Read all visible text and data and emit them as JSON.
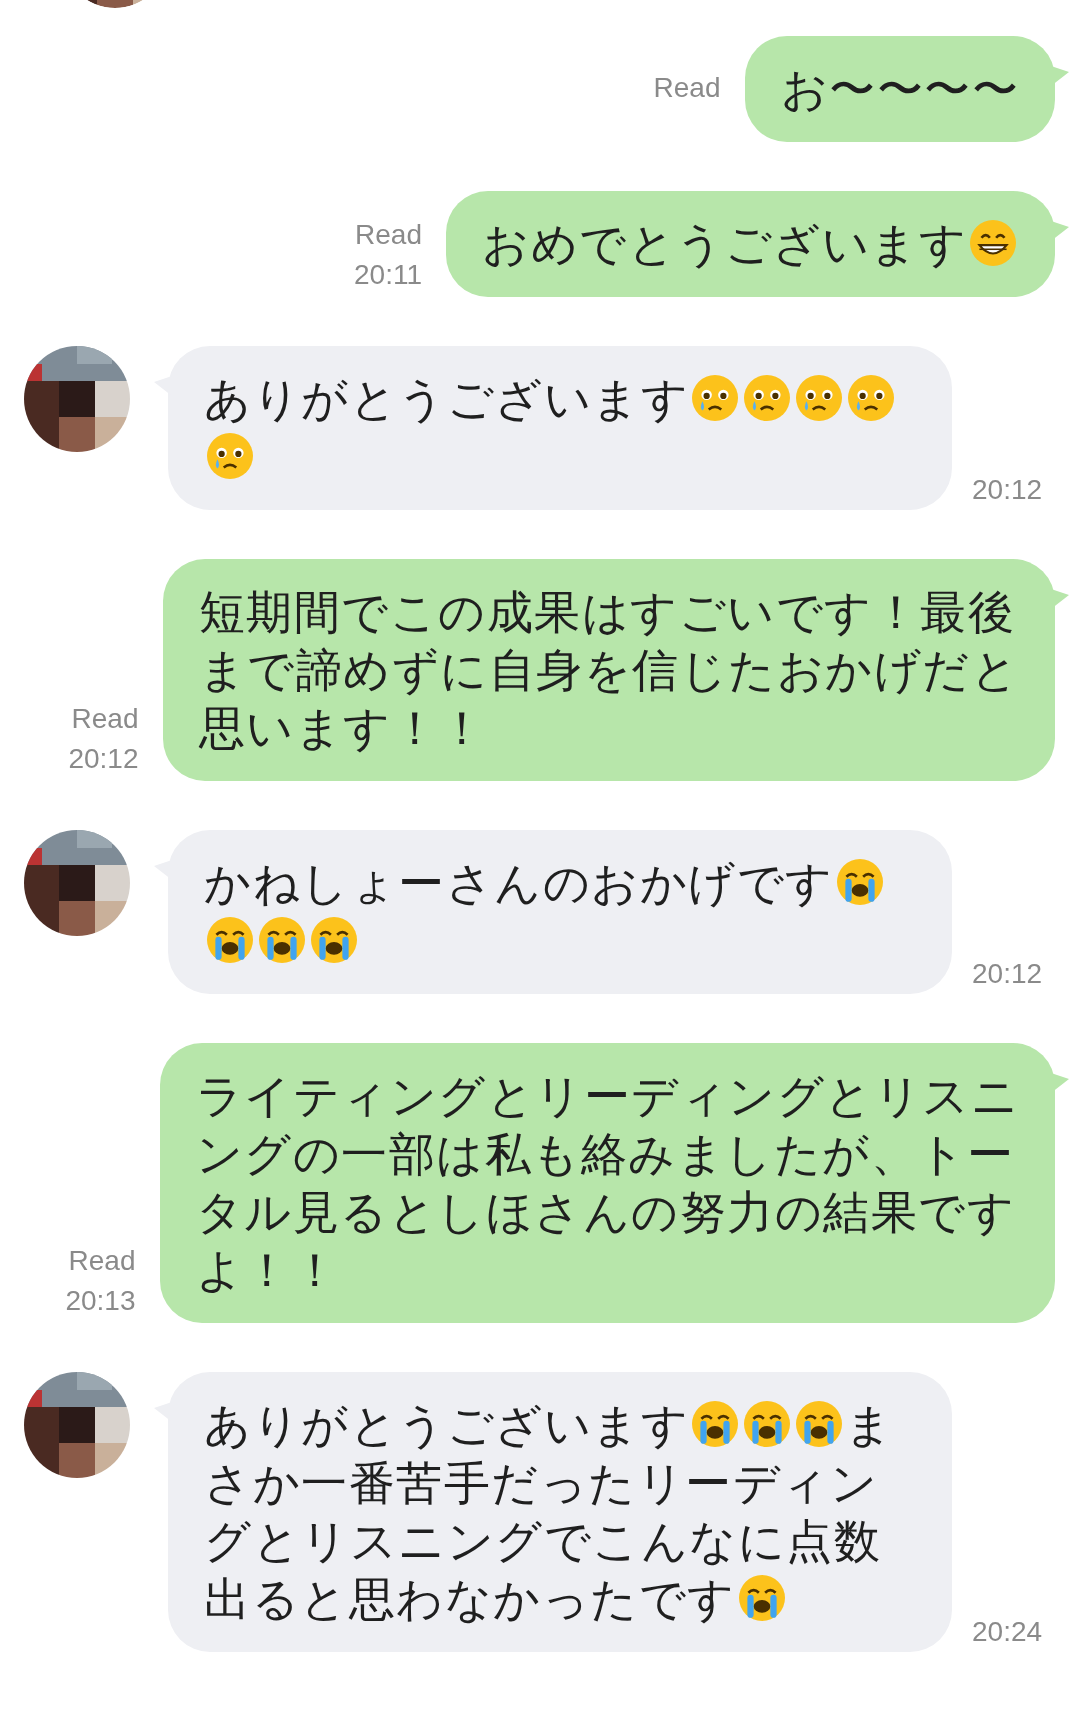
{
  "top_avatar": {
    "kind": "picture"
  },
  "messages": [
    {
      "kind": "sent",
      "read_label": "Read",
      "lines": [
        [
          {
            "kind": "text",
            "text": "お〜〜〜〜"
          }
        ]
      ]
    },
    {
      "kind": "sent",
      "read_label": "Read",
      "time": "20:11",
      "lines": [
        [
          {
            "kind": "text",
            "text": "おめでとうございます"
          },
          {
            "kind": "grin-emoji"
          }
        ]
      ]
    },
    {
      "kind": "received",
      "time": "20:12",
      "avatar": {
        "kind": "picture"
      },
      "lines": [
        [
          {
            "kind": "text",
            "text": "ありがとうございます"
          },
          {
            "kind": "tear-emoji"
          },
          {
            "kind": "tear-emoji"
          },
          {
            "kind": "tear-emoji"
          },
          {
            "kind": "tear-emoji"
          }
        ],
        [
          {
            "kind": "tear-emoji"
          }
        ]
      ]
    },
    {
      "kind": "sent",
      "read_label": "Read",
      "time": "20:12",
      "lines": [
        [
          {
            "kind": "text",
            "text": "短期間でこの成果はすごいです！最後"
          }
        ],
        [
          {
            "kind": "text",
            "text": "まで諦めずに自身を信じたおかげだと"
          }
        ],
        [
          {
            "kind": "text",
            "text": "思います！！"
          }
        ]
      ]
    },
    {
      "kind": "received",
      "time": "20:12",
      "avatar": {
        "kind": "picture"
      },
      "lines": [
        [
          {
            "kind": "text",
            "text": "かねしょーさんのおかげです"
          },
          {
            "kind": "sob-emoji"
          }
        ],
        [
          {
            "kind": "sob-emoji"
          },
          {
            "kind": "sob-emoji"
          },
          {
            "kind": "sob-emoji"
          }
        ]
      ]
    },
    {
      "kind": "sent",
      "read_label": "Read",
      "time": "20:13",
      "lines": [
        [
          {
            "kind": "text",
            "text": "ライティングとリーディングとリスニ"
          }
        ],
        [
          {
            "kind": "text",
            "text": "ングの一部は私も絡みましたが、トー"
          }
        ],
        [
          {
            "kind": "text",
            "text": "タル見るとしほさんの努力の結果です"
          }
        ],
        [
          {
            "kind": "text",
            "text": "よ！！"
          }
        ]
      ]
    },
    {
      "kind": "received",
      "time": "20:24",
      "avatar": {
        "kind": "picture"
      },
      "lines": [
        [
          {
            "kind": "text",
            "text": "ありがとうございます"
          },
          {
            "kind": "sob-emoji"
          },
          {
            "kind": "sob-emoji"
          },
          {
            "kind": "sob-emoji"
          },
          {
            "kind": "text",
            "text": "ま"
          }
        ],
        [
          {
            "kind": "text",
            "text": "さか一番苦手だったリーディン"
          }
        ],
        [
          {
            "kind": "text",
            "text": "グとリスニングでこんなに点数"
          }
        ],
        [
          {
            "kind": "text",
            "text": "出ると思わなかったです"
          },
          {
            "kind": "sob-emoji"
          }
        ]
      ]
    }
  ]
}
